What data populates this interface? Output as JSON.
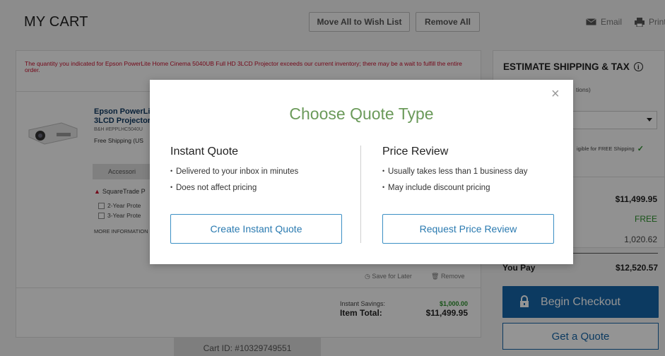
{
  "header": {
    "title": "MY CART",
    "move_all_label": "Move All to Wish List",
    "remove_all_label": "Remove All",
    "email_label": "Email",
    "print_label": "Print"
  },
  "cart": {
    "warning": "The quantity you indicated for Epson PowerLite Home Cinema 5040UB Full HD 3LCD Projector exceeds our current inventory; there may be a wait to fulfill the entire order.",
    "product_name_line1": "Epson PowerLi",
    "product_name_line2": "3LCD Projector",
    "product_sku": "B&H #EPPLHC5040U",
    "product_shipping": "Free Shipping (US",
    "accessories_label": "Accessori",
    "squaretrade_label": "SquareTrade P",
    "plan_2yr": "2-Year Prote",
    "plan_3yr": "3-Year Prote",
    "more_info": "MORE INFORMATION",
    "save_for_later": "Save for Later",
    "remove_label": "Remove",
    "instant_savings_label": "Instant Savings:",
    "instant_savings_value": "$1,000.00",
    "item_total_label": "Item Total:",
    "item_total_value": "$11,499.95",
    "cart_id": "Cart ID: #10329749551"
  },
  "summary": {
    "title": "ESTIMATE SHIPPING & TAX",
    "options_text": "tions)",
    "eligible_text": "igible for FREE Shipping",
    "subtotal": "$11,499.95",
    "shipping": "FREE",
    "tax": "1,020.62",
    "you_pay_label": "You Pay",
    "you_pay_value": "$12,520.57",
    "checkout_label": "Begin Checkout",
    "quote_label": "Get a Quote"
  },
  "modal": {
    "title": "Choose Quote Type",
    "close_glyph": "×",
    "instant": {
      "title": "Instant Quote",
      "bullets": [
        "Delivered to your inbox in minutes",
        "Does not affect pricing"
      ],
      "button_label": "Create Instant Quote"
    },
    "review": {
      "title": "Price Review",
      "bullets": [
        "Usually takes less than 1 business day",
        "May include discount pricing"
      ],
      "button_label": "Request Price Review"
    }
  },
  "colors": {
    "accent_blue": "#1565a8",
    "title_green": "#6b9a5a",
    "warning_red": "#c8102e"
  },
  "icons": [
    "email-icon",
    "print-icon",
    "info-icon",
    "lock-icon",
    "close-icon",
    "clock-icon",
    "trash-icon",
    "checkmark-icon"
  ]
}
